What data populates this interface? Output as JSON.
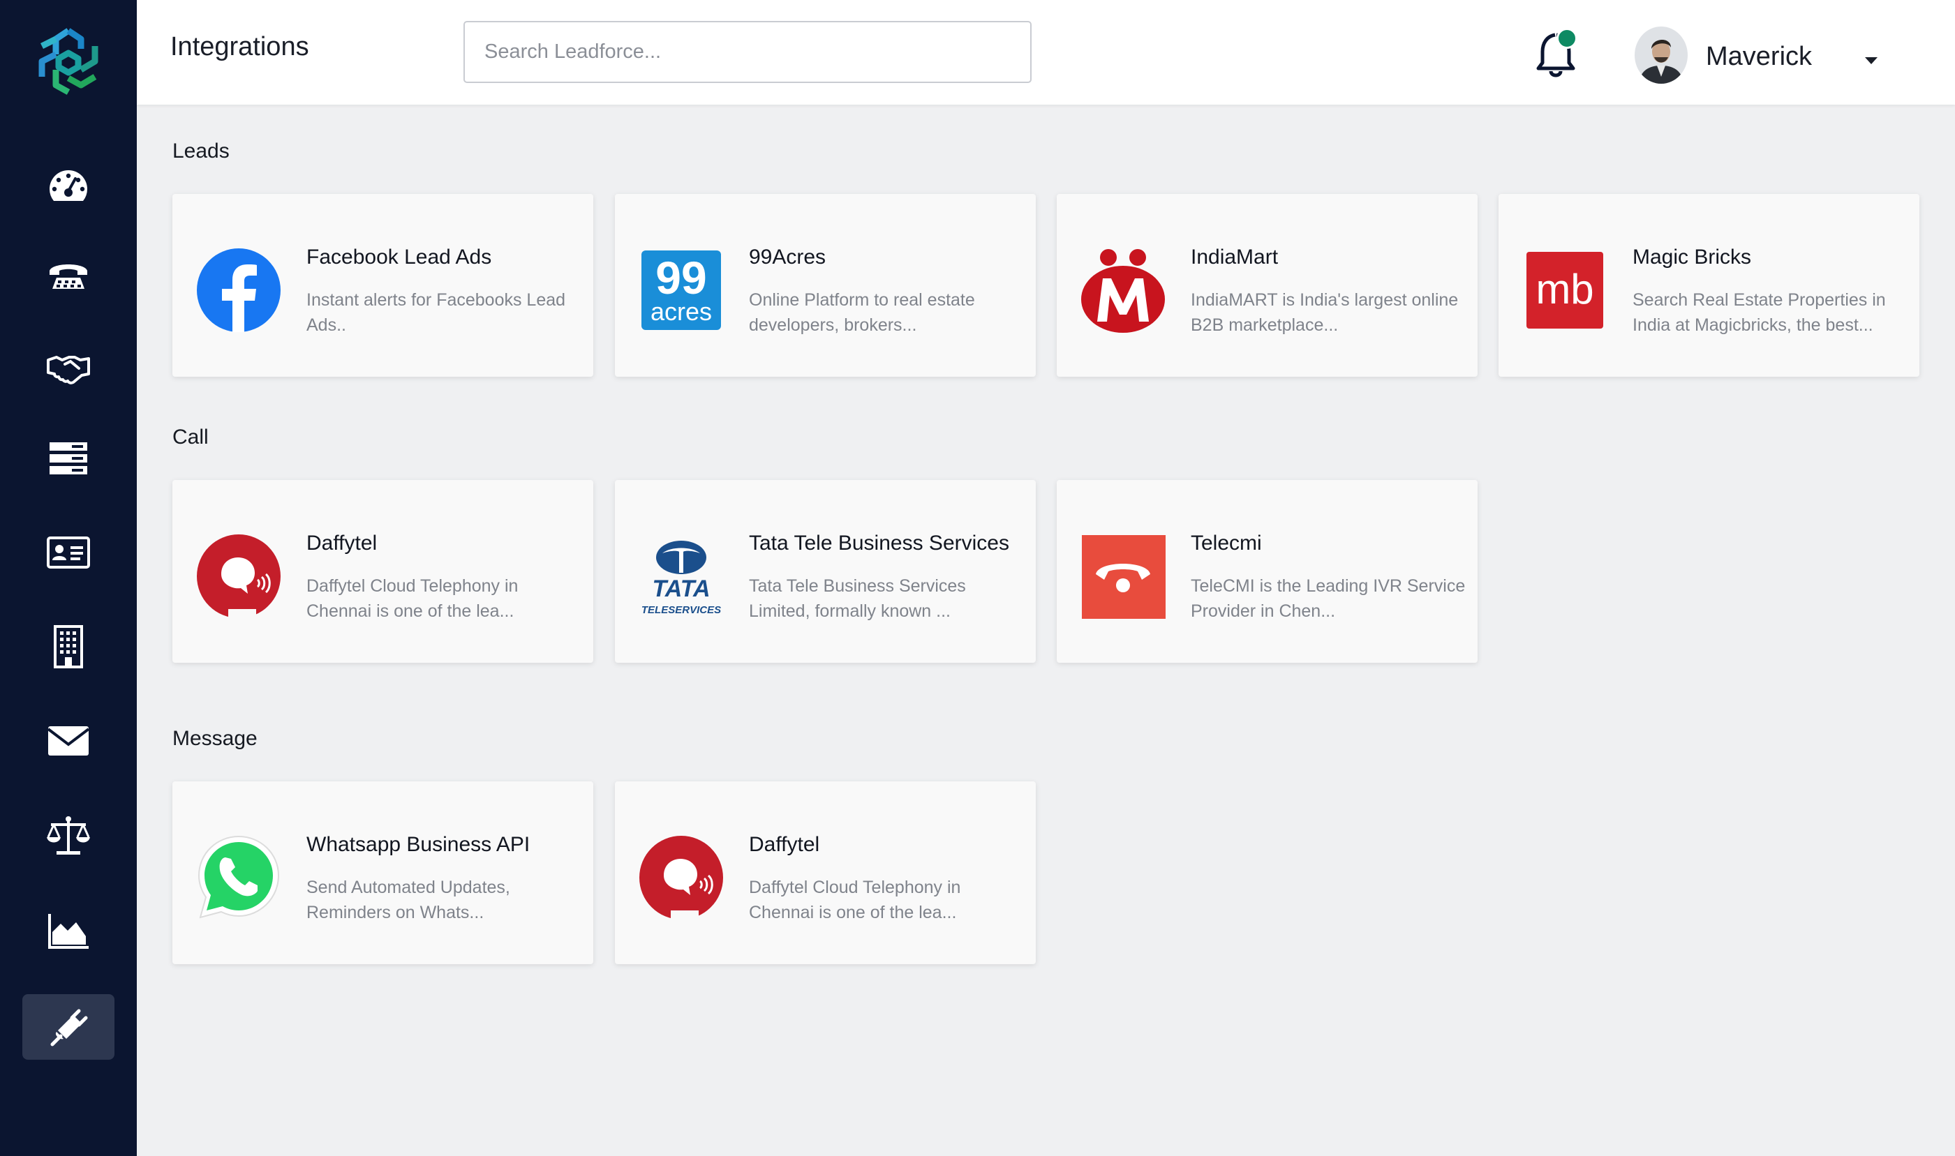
{
  "app": {
    "page_title": "Integrations",
    "search_placeholder": "Search Leadforce...",
    "user_name": "Maverick"
  },
  "colors": {
    "sidebar_bg": "#0b1530",
    "sidebar_active": "#2d3750",
    "notification_dot": "#0e8a63",
    "page_bg": "#eff0f2"
  },
  "sidebar": {
    "items": [
      {
        "icon": "dashboard-gauge-icon"
      },
      {
        "icon": "telephone-icon"
      },
      {
        "icon": "handshake-icon"
      },
      {
        "icon": "list-stack-icon"
      },
      {
        "icon": "contact-card-icon"
      },
      {
        "icon": "building-icon"
      },
      {
        "icon": "envelope-icon"
      },
      {
        "icon": "balance-scale-icon"
      },
      {
        "icon": "area-chart-icon"
      },
      {
        "icon": "plug-icon",
        "active": true
      }
    ]
  },
  "sections": [
    {
      "title": "Leads",
      "cards": [
        {
          "title": "Facebook Lead Ads",
          "desc": "Instant alerts for Facebooks Lead Ads..",
          "logo": "facebook-logo-icon"
        },
        {
          "title": "99Acres",
          "desc": "Online Platform to real estate developers, brokers...",
          "logo": "99acres-logo-icon",
          "logo_text_top": "99",
          "logo_text_bottom": "acres"
        },
        {
          "title": "IndiaMart",
          "desc": "IndiaMART is India's largest online B2B marketplace...",
          "logo": "indiamart-logo-icon"
        },
        {
          "title": "Magic Bricks",
          "desc": "Search Real Estate Properties in India at Magicbricks, the best...",
          "logo": "magicbricks-logo-icon",
          "logo_text": "mb"
        }
      ]
    },
    {
      "title": "Call",
      "cards": [
        {
          "title": "Daffytel",
          "desc": "Daffytel Cloud Telephony in Chennai is one of the lea...",
          "logo": "daffytel-logo-icon"
        },
        {
          "title": "Tata Tele Business Services",
          "desc": "Tata Tele Business Services Limited, formally known ...",
          "logo": "tata-teleservices-logo-icon",
          "logo_text_top": "TATA",
          "logo_text_bottom": "TELESERVICES"
        },
        {
          "title": "Telecmi",
          "desc": "TeleCMI is the Leading IVR Service Provider in Chen...",
          "logo": "telecmi-logo-icon"
        }
      ]
    },
    {
      "title": "Message",
      "cards": [
        {
          "title": "Whatsapp Business API",
          "desc": "Send Automated Updates, Reminders on Whats...",
          "logo": "whatsapp-logo-icon"
        },
        {
          "title": "Daffytel",
          "desc": "Daffytel Cloud Telephony in Chennai is one of the lea...",
          "logo": "daffytel-logo-icon"
        }
      ]
    }
  ]
}
